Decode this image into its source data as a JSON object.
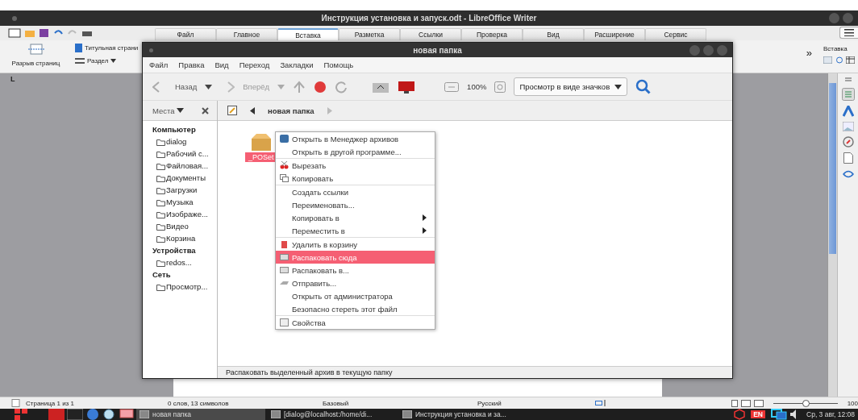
{
  "writer": {
    "title": "Инструкция установка и запуск.odt - LibreOffice Writer",
    "tabs": [
      {
        "label": "Файл",
        "selected": false
      },
      {
        "label": "Главное",
        "selected": false
      },
      {
        "label": "Вставка",
        "selected": true
      },
      {
        "label": "Разметка",
        "selected": false
      },
      {
        "label": "Ссылки",
        "selected": false
      },
      {
        "label": "Проверка",
        "selected": false
      },
      {
        "label": "Вид",
        "selected": false
      },
      {
        "label": "Расширение",
        "selected": false
      },
      {
        "label": "Сервис",
        "selected": false
      }
    ],
    "ribbon": {
      "page_break": "Разрыв страниц",
      "title_page": "Титульная страни",
      "section": "Раздел",
      "overflow": "»",
      "right_label": "Вставка"
    },
    "ruler_mark": "L",
    "status_bar": [
      "Страница 1 из 1",
      "0 слов, 13 символов",
      "Базовый",
      "Русский"
    ],
    "zoom": {
      "level": 0.5,
      "reading": "100"
    }
  },
  "file_manager": {
    "title": "новая папка",
    "menu": [
      "Файл",
      "Правка",
      "Вид",
      "Переход",
      "Закладки",
      "Помощь"
    ],
    "toolbar": {
      "back": "Назад",
      "forward": "Вперёд",
      "zoom": "100%",
      "view": "Просмотр в виде значков"
    },
    "places_label": "Места",
    "path": "новая папка",
    "sidebar": [
      {
        "heading": "Компьютер",
        "items": [
          "dialog",
          "Рабочий с...",
          "Файловая...",
          "Документы",
          "Загрузки",
          "Музыка",
          "Изображе...",
          "Видео",
          "Корзина"
        ]
      },
      {
        "heading": "Устройства",
        "items": [
          "redos..."
        ]
      },
      {
        "heading": "Сеть",
        "items": [
          "Просмотр..."
        ]
      }
    ],
    "file": {
      "name": "_POSet",
      "selected": true
    },
    "status": "Распаковать выделенный архив в текущую папку"
  },
  "context_menu": [
    [
      {
        "label": "Открыть в Менеджер архивов",
        "selected": false,
        "submenu": false
      },
      {
        "label": "Открыть в другой программе...",
        "selected": false,
        "submenu": false
      }
    ],
    [
      {
        "label": "Вырезать",
        "selected": false,
        "submenu": false
      },
      {
        "label": "Копировать",
        "selected": false,
        "submenu": false
      }
    ],
    [
      {
        "label": "Создать ссылки",
        "selected": false,
        "submenu": false
      },
      {
        "label": "Переименовать...",
        "selected": false,
        "submenu": false
      },
      {
        "label": "Копировать в",
        "selected": false,
        "submenu": true
      },
      {
        "label": "Переместить в",
        "selected": false,
        "submenu": true
      }
    ],
    [
      {
        "label": "Удалить в корзину",
        "selected": false,
        "submenu": false
      },
      {
        "label": "Распаковать сюда",
        "selected": true,
        "submenu": false
      },
      {
        "label": "Распаковать в...",
        "selected": false,
        "submenu": false
      },
      {
        "label": "Отправить...",
        "selected": false,
        "submenu": false
      },
      {
        "label": "Открыть от администратора",
        "selected": false,
        "submenu": false
      },
      {
        "label": "Безопасно стереть этот файл",
        "selected": false,
        "submenu": false
      }
    ],
    [
      {
        "label": "Свойства",
        "selected": false,
        "submenu": false
      }
    ]
  ],
  "taskbar": {
    "windows": [
      {
        "label": "новая папка",
        "selected": true
      },
      {
        "label": "[dialog@localhost:/home/di...",
        "selected": false
      },
      {
        "label": "Инструкция установка и за...",
        "selected": false
      }
    ],
    "language": "EN",
    "clock": "Ср, 3 авг, 12:08"
  }
}
